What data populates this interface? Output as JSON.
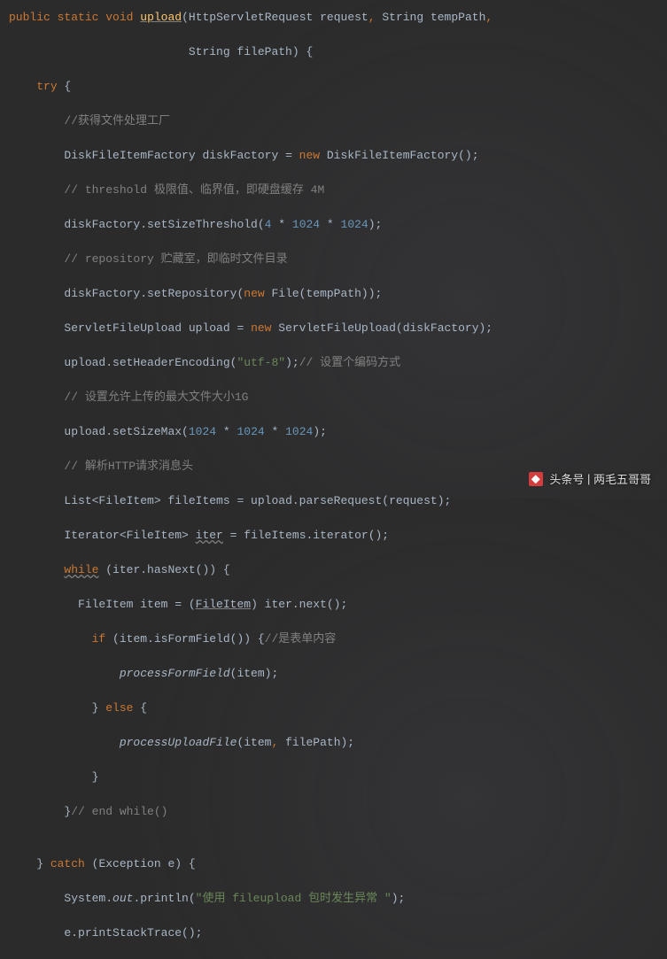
{
  "code": {
    "l1a": "public",
    "l1b": "static",
    "l1c": "void",
    "l1d": "upload",
    "l1e": "(HttpServletRequest request",
    "l1f": ",",
    "l1g": " String tempPath",
    "l1h": ",",
    "l2a": "String filePath) {",
    "l3a": "try",
    "l3b": " {",
    "l4": "//获得文件处理工厂",
    "l5a": "DiskFileItemFactory diskFactory = ",
    "l5b": "new",
    "l5c": " DiskFileItemFactory();",
    "l6": "// threshold 极限值、临界值，即硬盘缓存 4M",
    "l7a": "diskFactory.setSizeThreshold(",
    "l7b": "4",
    "l7c": " * ",
    "l7d": "1024",
    "l7e": " * ",
    "l7f": "1024",
    "l7g": ");",
    "l8": "// repository 贮藏室，即临时文件目录",
    "l9a": "diskFactory.setRepository(",
    "l9b": "new",
    "l9c": " File(tempPath));",
    "l10a": "ServletFileUpload upload = ",
    "l10b": "new",
    "l10c": " ServletFileUpload(diskFactory);",
    "l11a": "upload.setHeaderEncoding(",
    "l11b": "\"utf-8\"",
    "l11c": ");",
    "l11d": "// 设置个编码方式",
    "l12": "// 设置允许上传的最大文件大小1G",
    "l13a": "upload.setSizeMax(",
    "l13b": "1024",
    "l13c": " * ",
    "l13d": "1024",
    "l13e": " * ",
    "l13f": "1024",
    "l13g": ");",
    "l14": "// 解析HTTP请求消息头",
    "l15a": "List<FileItem> fileItems = upload.parseRequest(request);",
    "l16a": "Iterator<FileItem> ",
    "l16b": "iter",
    "l16c": " = fileItems.iterator();",
    "l17a": "while",
    "l17b": " (iter.hasNext()) {",
    "l18a": "FileItem item = (",
    "l18b": "FileItem",
    "l18c": ") iter.next();",
    "l19a": "if",
    "l19b": " (item.isFormField()) {",
    "l19c": "//是表单内容",
    "l20a": "processFormField",
    "l20b": "(item);",
    "l21a": "} ",
    "l21b": "else",
    "l21c": " {",
    "l22a": "processUploadFile",
    "l22b": "(item",
    "l22c": ",",
    "l22d": " filePath);",
    "l23": "}",
    "l24a": "}",
    "l24b": "// end while()",
    "l25a": "} ",
    "l25b": "catch",
    "l25c": " (Exception e) {",
    "l26a": "System.",
    "l26b": "out",
    "l26c": ".println(",
    "l26d": "\"使用 fileupload 包时发生异常 \"",
    "l26e": ");",
    "l27": "e.printStackTrace();"
  },
  "watermark": {
    "prefix": "头条号",
    "name": "两毛五哥哥"
  }
}
